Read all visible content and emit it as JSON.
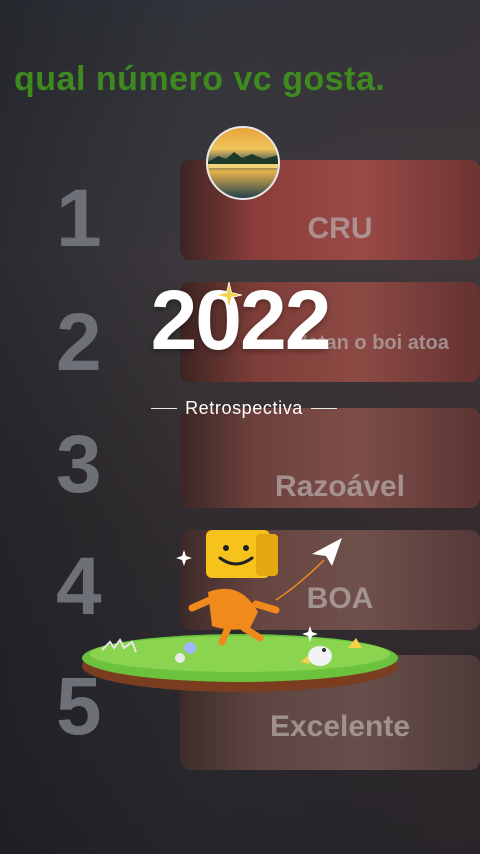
{
  "headline": "qual número vc gosta.",
  "year": "2022",
  "subtitle": "Retrospectiva",
  "ranking": [
    {
      "number": "1",
      "label": "CRU"
    },
    {
      "number": "2",
      "label": "Matan o boi atoa"
    },
    {
      "number": "3",
      "label": "Razoável"
    },
    {
      "number": "4",
      "label": "BOA"
    },
    {
      "number": "5",
      "label": "Excelente"
    }
  ],
  "colors": {
    "headline": "#3f8a1f",
    "year": "#ffffff",
    "accent_star": "#f4d24a"
  },
  "icons": [
    "sparkle-icon",
    "paper-plane-icon",
    "mascot-illustration",
    "avatar-image"
  ]
}
